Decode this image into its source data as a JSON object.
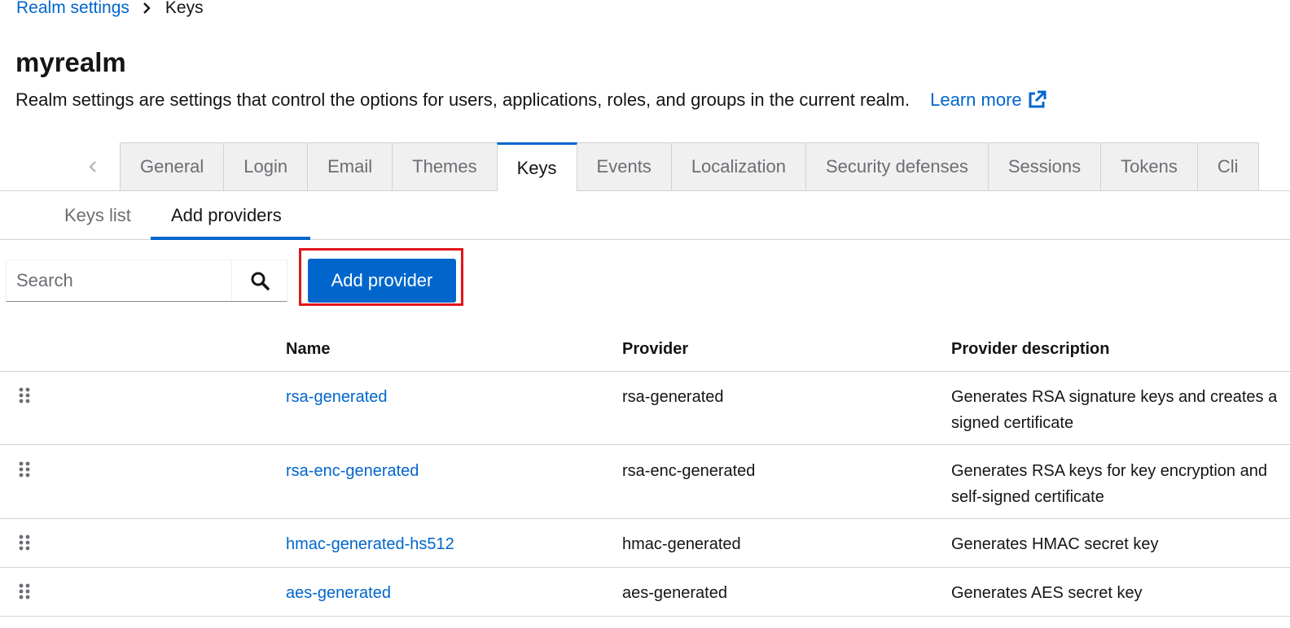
{
  "breadcrumb": {
    "parent": "Realm settings",
    "current": "Keys"
  },
  "page": {
    "title": "myrealm",
    "description": "Realm settings are settings that control the options for users, applications, roles, and groups in the current realm.",
    "learn_more": "Learn more"
  },
  "tabs": [
    "General",
    "Login",
    "Email",
    "Themes",
    "Keys",
    "Events",
    "Localization",
    "Security defenses",
    "Sessions",
    "Tokens",
    "Cli"
  ],
  "active_tab": "Keys",
  "sub_tabs": [
    "Keys list",
    "Add providers"
  ],
  "active_sub_tab": "Add providers",
  "search": {
    "placeholder": "Search"
  },
  "add_provider_label": "Add provider",
  "table": {
    "headers": {
      "name": "Name",
      "provider": "Provider",
      "description": "Provider description"
    },
    "rows": [
      {
        "name": "rsa-generated",
        "provider": "rsa-generated",
        "desc1": "Generates RSA signature keys and creates a",
        "desc2": "signed certificate"
      },
      {
        "name": "rsa-enc-generated",
        "provider": "rsa-enc-generated",
        "desc1": "Generates RSA keys for key encryption and",
        "desc2": "self-signed certificate"
      },
      {
        "name": "hmac-generated-hs512",
        "provider": "hmac-generated",
        "desc1": "Generates HMAC secret key",
        "desc2": ""
      },
      {
        "name": "aes-generated",
        "provider": "aes-generated",
        "desc1": "Generates AES secret key",
        "desc2": ""
      }
    ]
  },
  "colors": {
    "link": "#0066cc",
    "primary": "#0066cc",
    "highlight": "#e3141b"
  }
}
